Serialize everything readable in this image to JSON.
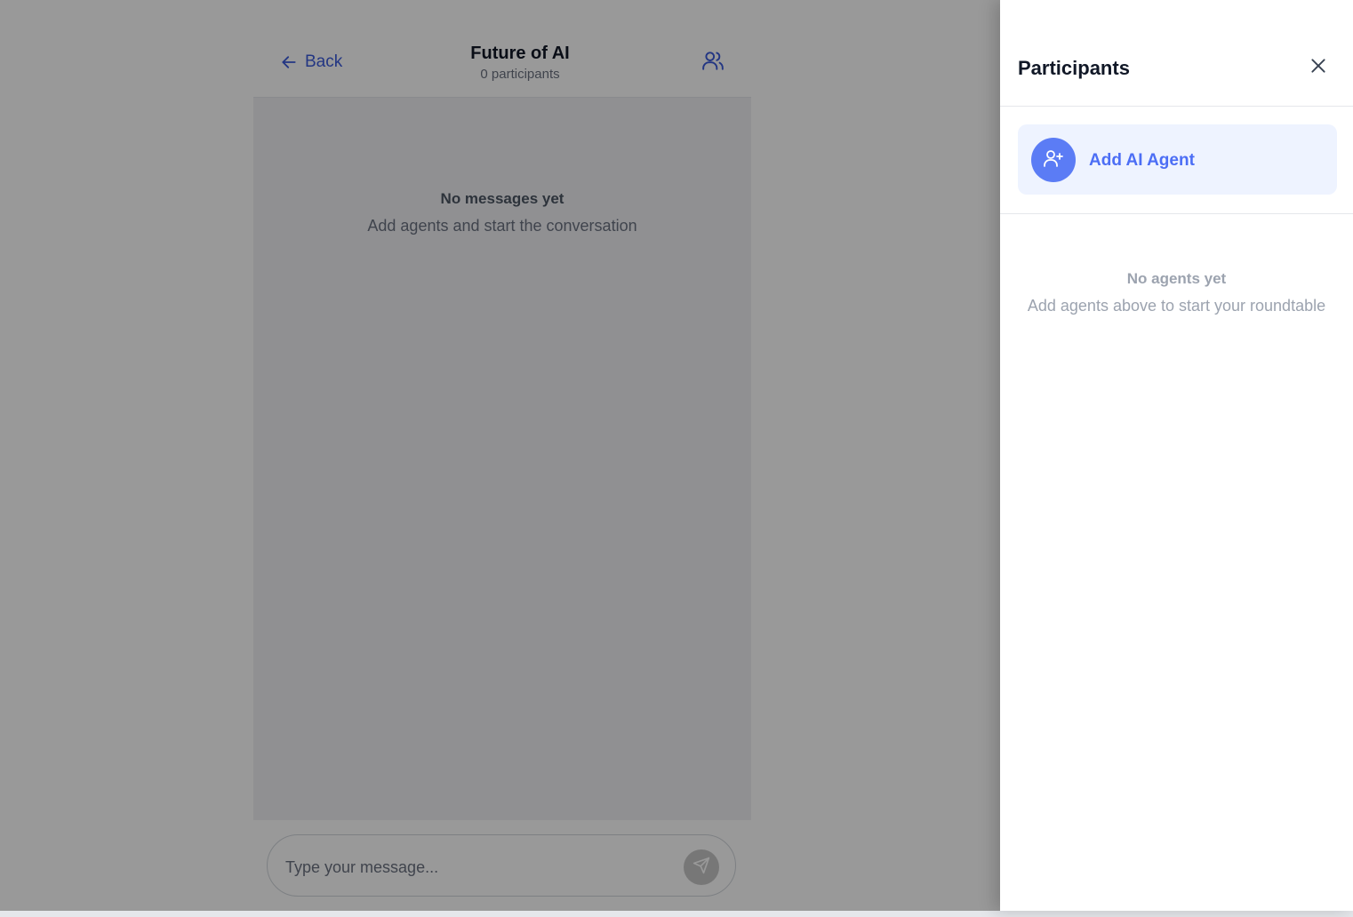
{
  "chat": {
    "back_label": "Back",
    "title": "Future of AI",
    "subtitle": "0 participants",
    "empty_title": "No messages yet",
    "empty_subtitle": "Add agents and start the conversation",
    "composer_placeholder": "Type your message..."
  },
  "panel": {
    "title": "Participants",
    "add_agent_label": "Add AI Agent",
    "empty_title": "No agents yet",
    "empty_subtitle": "Add agents above to start your roundtable"
  },
  "icons": {
    "back": "arrow-left-icon",
    "participants": "users-icon",
    "send": "send-icon",
    "close": "close-icon",
    "add_user": "user-plus-icon"
  },
  "colors": {
    "accent": "#4c6ef5",
    "avatar_bg": "#5b7cf5",
    "add_agent_bg": "#eef3ff",
    "overlay": "rgba(0,0,0,0.40)"
  }
}
